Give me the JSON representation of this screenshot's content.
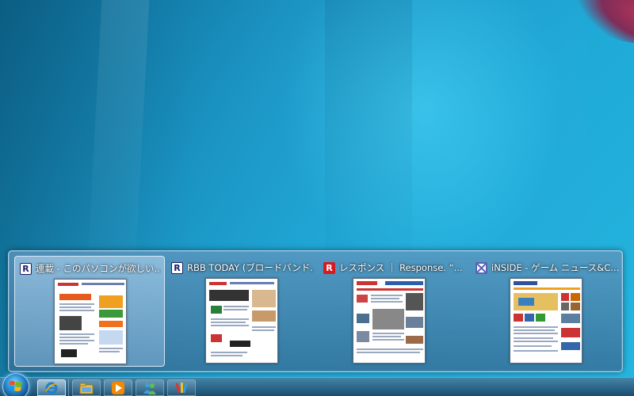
{
  "thumbnails": [
    {
      "title": "連載 - このパソコンが欲しい...",
      "favicon": "rbb-r-icon",
      "active": true
    },
    {
      "title": "RBB TODAY (ブロードバンド...",
      "favicon": "rbb-r-icon",
      "active": false
    },
    {
      "title": "レスポンス ｜ Response. “...",
      "favicon": "response-r-icon",
      "active": false
    },
    {
      "title": "iNSIDE - ゲーム ニュース&C...",
      "favicon": "inside-icon",
      "active": false
    }
  ],
  "taskbar": {
    "start": "windows-start-orb-icon",
    "pinned": [
      {
        "icon": "internet-explorer-icon",
        "active": true
      },
      {
        "icon": "windows-explorer-icon",
        "active": false
      },
      {
        "icon": "media-player-icon",
        "active": false
      },
      {
        "icon": "windows-live-messenger-icon",
        "active": false
      },
      {
        "icon": "paint-icon",
        "active": false
      }
    ]
  },
  "colors": {
    "accent": "#1fa9d6",
    "taskbar": "#2a6f98"
  }
}
